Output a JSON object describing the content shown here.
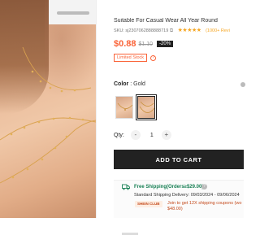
{
  "product": {
    "title": "Suitable For Casual Wear All Year Round",
    "sku_label": "SKU: sj2307062888888719",
    "rating_stars": "★★★★★",
    "rating_value": "",
    "reviews": "(1000+ Revi",
    "price": "$0.88",
    "original_price": "$1.10",
    "discount": "-20%",
    "limited_stock": "Limited Stock",
    "info_icon": "?"
  },
  "color": {
    "label": "Color",
    "separator": " : ",
    "value": "Gold"
  },
  "quantity": {
    "label": "Qty:",
    "minus": "-",
    "value": "1",
    "plus": "+"
  },
  "cart": {
    "add_label": "ADD TO CART"
  },
  "shipping": {
    "title": "Free Shipping(Orders≥$29.00)",
    "help_icon": "?",
    "standard": "Standard Shipping Delivery: 09/03/2024 - 09/06/2024",
    "club_badge": "SHEIN CLUB",
    "club_text_1": "Join to get 12X shipping coupons (wo",
    "club_text_2": "$48.00)"
  },
  "colors": {
    "accent": "#fa6338",
    "star": "#f5a623",
    "ship_green": "#198055",
    "button_dark": "#222222"
  }
}
